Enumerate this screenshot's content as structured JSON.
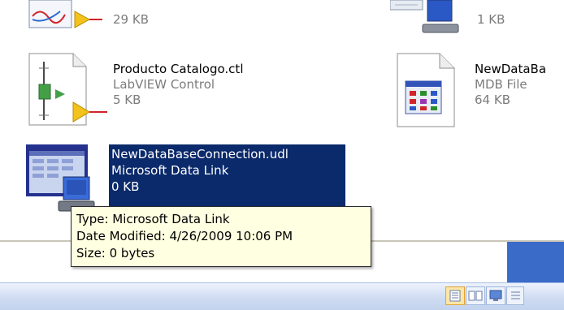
{
  "files": [
    {
      "name": "",
      "type": "",
      "size": "29 KB"
    },
    {
      "name": "",
      "type": "",
      "size": "1 KB"
    },
    {
      "name": "Producto Catalogo.ctl",
      "type": "LabVIEW Control",
      "size": "5 KB"
    },
    {
      "name": "NewDataBa",
      "type": "MDB File",
      "size": "64 KB"
    },
    {
      "name": "NewDataBaseConnection.udl",
      "type": "Microsoft Data Link",
      "size": "0 KB",
      "selected": true
    }
  ],
  "tooltip": {
    "type_line": "Type: Microsoft Data Link",
    "date_line": "Date Modified: 4/26/2009 10:06 PM",
    "size_line": "Size: 0 bytes"
  },
  "view_buttons": [
    "list-view-icon",
    "filmstrip-view-icon",
    "thumbnail-view-icon",
    "details-view-icon"
  ],
  "colors": {
    "selection": "#0b2a6b",
    "tooltip_bg": "#ffffe1",
    "panel_blue": "#3a6bc9"
  }
}
